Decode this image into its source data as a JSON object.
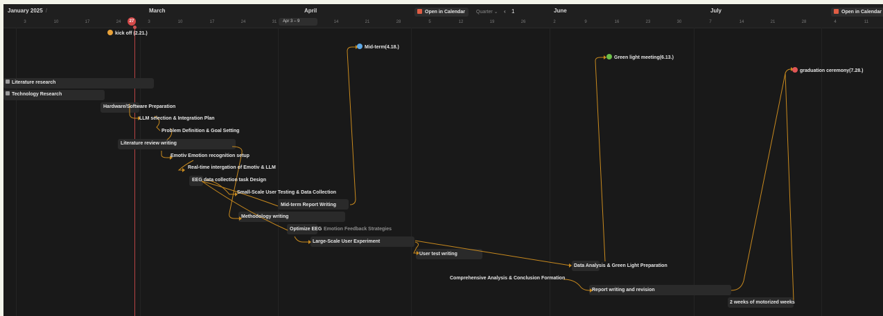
{
  "header": {
    "months": [
      {
        "label": "January 2025",
        "slash": "/"
      },
      {
        "label": "March"
      },
      {
        "label": "April"
      },
      {
        "label": "June"
      },
      {
        "label": "July"
      }
    ],
    "days": [
      "3",
      "10",
      "17",
      "24",
      "3",
      "10",
      "17",
      "24",
      "31",
      "14",
      "21",
      "28",
      "5",
      "12",
      "19",
      "26",
      "2",
      "9",
      "16",
      "23",
      "30",
      "7",
      "14",
      "21",
      "28",
      "4",
      "11"
    ],
    "today_day": "27",
    "range_pill": "Apr 3 – 9",
    "open_calendar_label": "Open in Calendar",
    "view_select": "Quarter ⌄",
    "prev_icon": "‹",
    "page_number": "1"
  },
  "milestones": [
    {
      "label": "kick off  (2.21.)",
      "icon": "smiley-icon",
      "color": "#e8a23a"
    },
    {
      "label": "Mid-term(4.18.)",
      "icon": "blue-heart-icon",
      "color": "#5ea9e8"
    },
    {
      "label": "Green light meeting(6.13.)",
      "icon": "green-heart-icon",
      "color": "#6cc04a"
    },
    {
      "label": "graduation ceremony(7.28.)",
      "icon": "party-icon",
      "color": "#e05555"
    }
  ],
  "tasks": [
    "Literature research",
    "Technology Research",
    "Hardware/Software Preparation",
    "LLM selection & Integration Plan",
    "Problem Definition & Goal Setting",
    "Literature review writing",
    "Emotiv Emotion recognition setup",
    "Real-time intergation of Emotiv & LLM",
    "EEG data collection task Design",
    "Small-Scale User Testing & Data Collection",
    "Mid-term Report Writing",
    "Methodology writing",
    "Optimize EEG",
    "Emotion Feedback Strategies",
    "Large-Scale User Experiment",
    "User test writing",
    "Data Analysis & Green Light Preparation",
    "Comprehensive Analysis & Conclusion Formation",
    "Report writing and revision",
    "2 weeks of motorized weeks"
  ],
  "colors": {
    "background": "#191919",
    "link": "#c98a1e",
    "today": "#d24848",
    "bar": "#2a2a2a"
  }
}
